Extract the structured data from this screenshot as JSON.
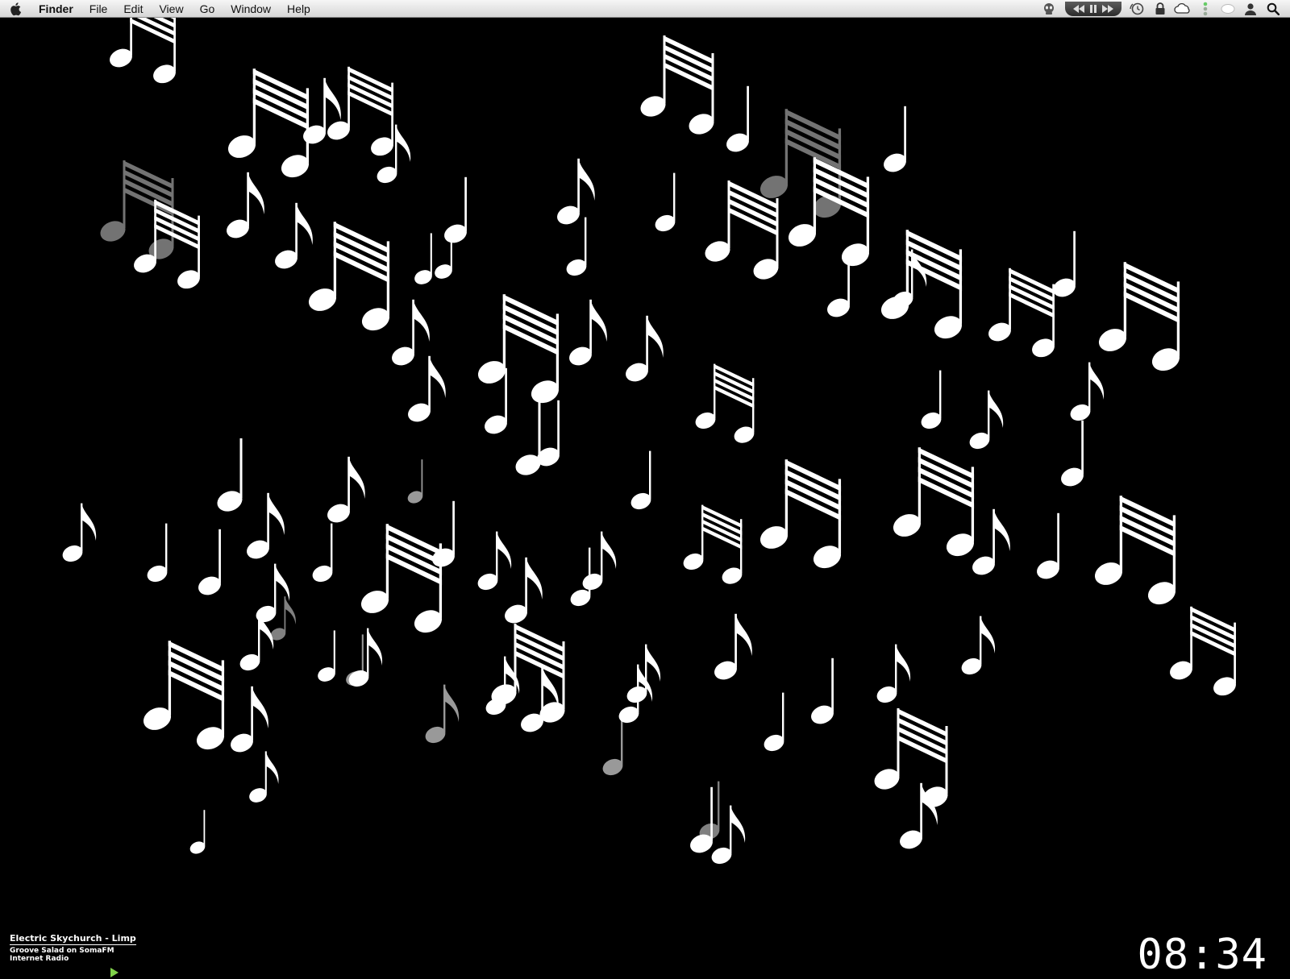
{
  "menubar": {
    "app_name": "Finder",
    "items": [
      {
        "id": "file",
        "label": "File"
      },
      {
        "id": "edit",
        "label": "Edit"
      },
      {
        "id": "view",
        "label": "View"
      },
      {
        "id": "go",
        "label": "Go"
      },
      {
        "id": "window",
        "label": "Window"
      },
      {
        "id": "help",
        "label": "Help"
      }
    ],
    "status_icons": [
      "alien-icon",
      "media-transport-icon",
      "time-machine-icon",
      "lock-icon",
      "cloud-icon",
      "traffic-light-icon",
      "speech-bubble-icon",
      "user-icon",
      "spotlight-search-icon"
    ]
  },
  "now_playing": {
    "title": "Electric Skychurch - Limp",
    "station": "Groove Salad on SomaFM",
    "type": "Internet Radio",
    "play_icon": "play-icon",
    "accent": "#7fd14a"
  },
  "clock": {
    "time": "08:34"
  },
  "screensaver": {
    "description_icon": "music-notes-screensaver",
    "note_color": "#ffffff",
    "background": "#000000"
  }
}
